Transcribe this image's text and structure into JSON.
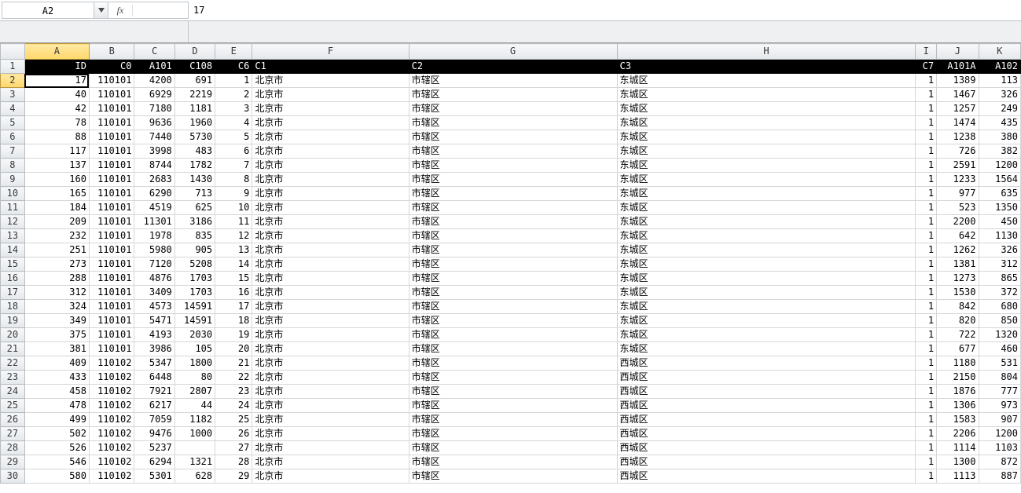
{
  "nameBox": {
    "ref": "A2"
  },
  "formula": {
    "fxLabel": "fx",
    "value": "17"
  },
  "columns": [
    "A",
    "B",
    "C",
    "D",
    "E",
    "F",
    "G",
    "H",
    "I",
    "J",
    "K"
  ],
  "headerRow": {
    "A": "ID",
    "B": "C0",
    "C": "A101",
    "D": "C108",
    "E": "C6",
    "F": "C1",
    "G": "C2",
    "H": "C3",
    "I": "C7",
    "J": "A101A",
    "K": "A102"
  },
  "rows": [
    {
      "n": 2,
      "A": "17",
      "B": "110101",
      "C": "4200",
      "D": "691",
      "E": "1",
      "F": "北京市",
      "G": "市辖区",
      "H": "东城区",
      "I": "1",
      "J": "1389",
      "K": "113"
    },
    {
      "n": 3,
      "A": "40",
      "B": "110101",
      "C": "6929",
      "D": "2219",
      "E": "2",
      "F": "北京市",
      "G": "市辖区",
      "H": "东城区",
      "I": "1",
      "J": "1467",
      "K": "326"
    },
    {
      "n": 4,
      "A": "42",
      "B": "110101",
      "C": "7180",
      "D": "1181",
      "E": "3",
      "F": "北京市",
      "G": "市辖区",
      "H": "东城区",
      "I": "1",
      "J": "1257",
      "K": "249"
    },
    {
      "n": 5,
      "A": "78",
      "B": "110101",
      "C": "9636",
      "D": "1960",
      "E": "4",
      "F": "北京市",
      "G": "市辖区",
      "H": "东城区",
      "I": "1",
      "J": "1474",
      "K": "435"
    },
    {
      "n": 6,
      "A": "88",
      "B": "110101",
      "C": "7440",
      "D": "5730",
      "E": "5",
      "F": "北京市",
      "G": "市辖区",
      "H": "东城区",
      "I": "1",
      "J": "1238",
      "K": "380"
    },
    {
      "n": 7,
      "A": "117",
      "B": "110101",
      "C": "3998",
      "D": "483",
      "E": "6",
      "F": "北京市",
      "G": "市辖区",
      "H": "东城区",
      "I": "1",
      "J": "726",
      "K": "382"
    },
    {
      "n": 8,
      "A": "137",
      "B": "110101",
      "C": "8744",
      "D": "1782",
      "E": "7",
      "F": "北京市",
      "G": "市辖区",
      "H": "东城区",
      "I": "1",
      "J": "2591",
      "K": "1200"
    },
    {
      "n": 9,
      "A": "160",
      "B": "110101",
      "C": "2683",
      "D": "1430",
      "E": "8",
      "F": "北京市",
      "G": "市辖区",
      "H": "东城区",
      "I": "1",
      "J": "1233",
      "K": "1564"
    },
    {
      "n": 10,
      "A": "165",
      "B": "110101",
      "C": "6290",
      "D": "713",
      "E": "9",
      "F": "北京市",
      "G": "市辖区",
      "H": "东城区",
      "I": "1",
      "J": "977",
      "K": "635"
    },
    {
      "n": 11,
      "A": "184",
      "B": "110101",
      "C": "4519",
      "D": "625",
      "E": "10",
      "F": "北京市",
      "G": "市辖区",
      "H": "东城区",
      "I": "1",
      "J": "523",
      "K": "1350"
    },
    {
      "n": 12,
      "A": "209",
      "B": "110101",
      "C": "11301",
      "D": "3186",
      "E": "11",
      "F": "北京市",
      "G": "市辖区",
      "H": "东城区",
      "I": "1",
      "J": "2200",
      "K": "450"
    },
    {
      "n": 13,
      "A": "232",
      "B": "110101",
      "C": "1978",
      "D": "835",
      "E": "12",
      "F": "北京市",
      "G": "市辖区",
      "H": "东城区",
      "I": "1",
      "J": "642",
      "K": "1130"
    },
    {
      "n": 14,
      "A": "251",
      "B": "110101",
      "C": "5980",
      "D": "905",
      "E": "13",
      "F": "北京市",
      "G": "市辖区",
      "H": "东城区",
      "I": "1",
      "J": "1262",
      "K": "326"
    },
    {
      "n": 15,
      "A": "273",
      "B": "110101",
      "C": "7120",
      "D": "5208",
      "E": "14",
      "F": "北京市",
      "G": "市辖区",
      "H": "东城区",
      "I": "1",
      "J": "1381",
      "K": "312"
    },
    {
      "n": 16,
      "A": "288",
      "B": "110101",
      "C": "4876",
      "D": "1703",
      "E": "15",
      "F": "北京市",
      "G": "市辖区",
      "H": "东城区",
      "I": "1",
      "J": "1273",
      "K": "865"
    },
    {
      "n": 17,
      "A": "312",
      "B": "110101",
      "C": "3409",
      "D": "1703",
      "E": "16",
      "F": "北京市",
      "G": "市辖区",
      "H": "东城区",
      "I": "1",
      "J": "1530",
      "K": "372"
    },
    {
      "n": 18,
      "A": "324",
      "B": "110101",
      "C": "4573",
      "D": "14591",
      "E": "17",
      "F": "北京市",
      "G": "市辖区",
      "H": "东城区",
      "I": "1",
      "J": "842",
      "K": "680"
    },
    {
      "n": 19,
      "A": "349",
      "B": "110101",
      "C": "5471",
      "D": "14591",
      "E": "18",
      "F": "北京市",
      "G": "市辖区",
      "H": "东城区",
      "I": "1",
      "J": "820",
      "K": "850"
    },
    {
      "n": 20,
      "A": "375",
      "B": "110101",
      "C": "4193",
      "D": "2030",
      "E": "19",
      "F": "北京市",
      "G": "市辖区",
      "H": "东城区",
      "I": "1",
      "J": "722",
      "K": "1320"
    },
    {
      "n": 21,
      "A": "381",
      "B": "110101",
      "C": "3986",
      "D": "105",
      "E": "20",
      "F": "北京市",
      "G": "市辖区",
      "H": "东城区",
      "I": "1",
      "J": "677",
      "K": "460"
    },
    {
      "n": 22,
      "A": "409",
      "B": "110102",
      "C": "5347",
      "D": "1800",
      "E": "21",
      "F": "北京市",
      "G": "市辖区",
      "H": "西城区",
      "I": "1",
      "J": "1180",
      "K": "531"
    },
    {
      "n": 23,
      "A": "433",
      "B": "110102",
      "C": "6448",
      "D": "80",
      "E": "22",
      "F": "北京市",
      "G": "市辖区",
      "H": "西城区",
      "I": "1",
      "J": "2150",
      "K": "804"
    },
    {
      "n": 24,
      "A": "458",
      "B": "110102",
      "C": "7921",
      "D": "2807",
      "E": "23",
      "F": "北京市",
      "G": "市辖区",
      "H": "西城区",
      "I": "1",
      "J": "1876",
      "K": "777"
    },
    {
      "n": 25,
      "A": "478",
      "B": "110102",
      "C": "6217",
      "D": "44",
      "E": "24",
      "F": "北京市",
      "G": "市辖区",
      "H": "西城区",
      "I": "1",
      "J": "1306",
      "K": "973"
    },
    {
      "n": 26,
      "A": "499",
      "B": "110102",
      "C": "7059",
      "D": "1182",
      "E": "25",
      "F": "北京市",
      "G": "市辖区",
      "H": "西城区",
      "I": "1",
      "J": "1583",
      "K": "907"
    },
    {
      "n": 27,
      "A": "502",
      "B": "110102",
      "C": "9476",
      "D": "1000",
      "E": "26",
      "F": "北京市",
      "G": "市辖区",
      "H": "西城区",
      "I": "1",
      "J": "2206",
      "K": "1200"
    },
    {
      "n": 28,
      "A": "526",
      "B": "110102",
      "C": "5237",
      "D": "",
      "E": "27",
      "F": "北京市",
      "G": "市辖区",
      "H": "西城区",
      "I": "1",
      "J": "1114",
      "K": "1103"
    },
    {
      "n": 29,
      "A": "546",
      "B": "110102",
      "C": "6294",
      "D": "1321",
      "E": "28",
      "F": "北京市",
      "G": "市辖区",
      "H": "西城区",
      "I": "1",
      "J": "1300",
      "K": "872"
    },
    {
      "n": 30,
      "A": "580",
      "B": "110102",
      "C": "5301",
      "D": "628",
      "E": "29",
      "F": "北京市",
      "G": "市辖区",
      "H": "西城区",
      "I": "1",
      "J": "1113",
      "K": "887"
    }
  ],
  "activeCell": "A2",
  "numericCols": [
    "A",
    "B",
    "C",
    "D",
    "E",
    "I",
    "J",
    "K"
  ],
  "textCols": [
    "F",
    "G",
    "H"
  ]
}
